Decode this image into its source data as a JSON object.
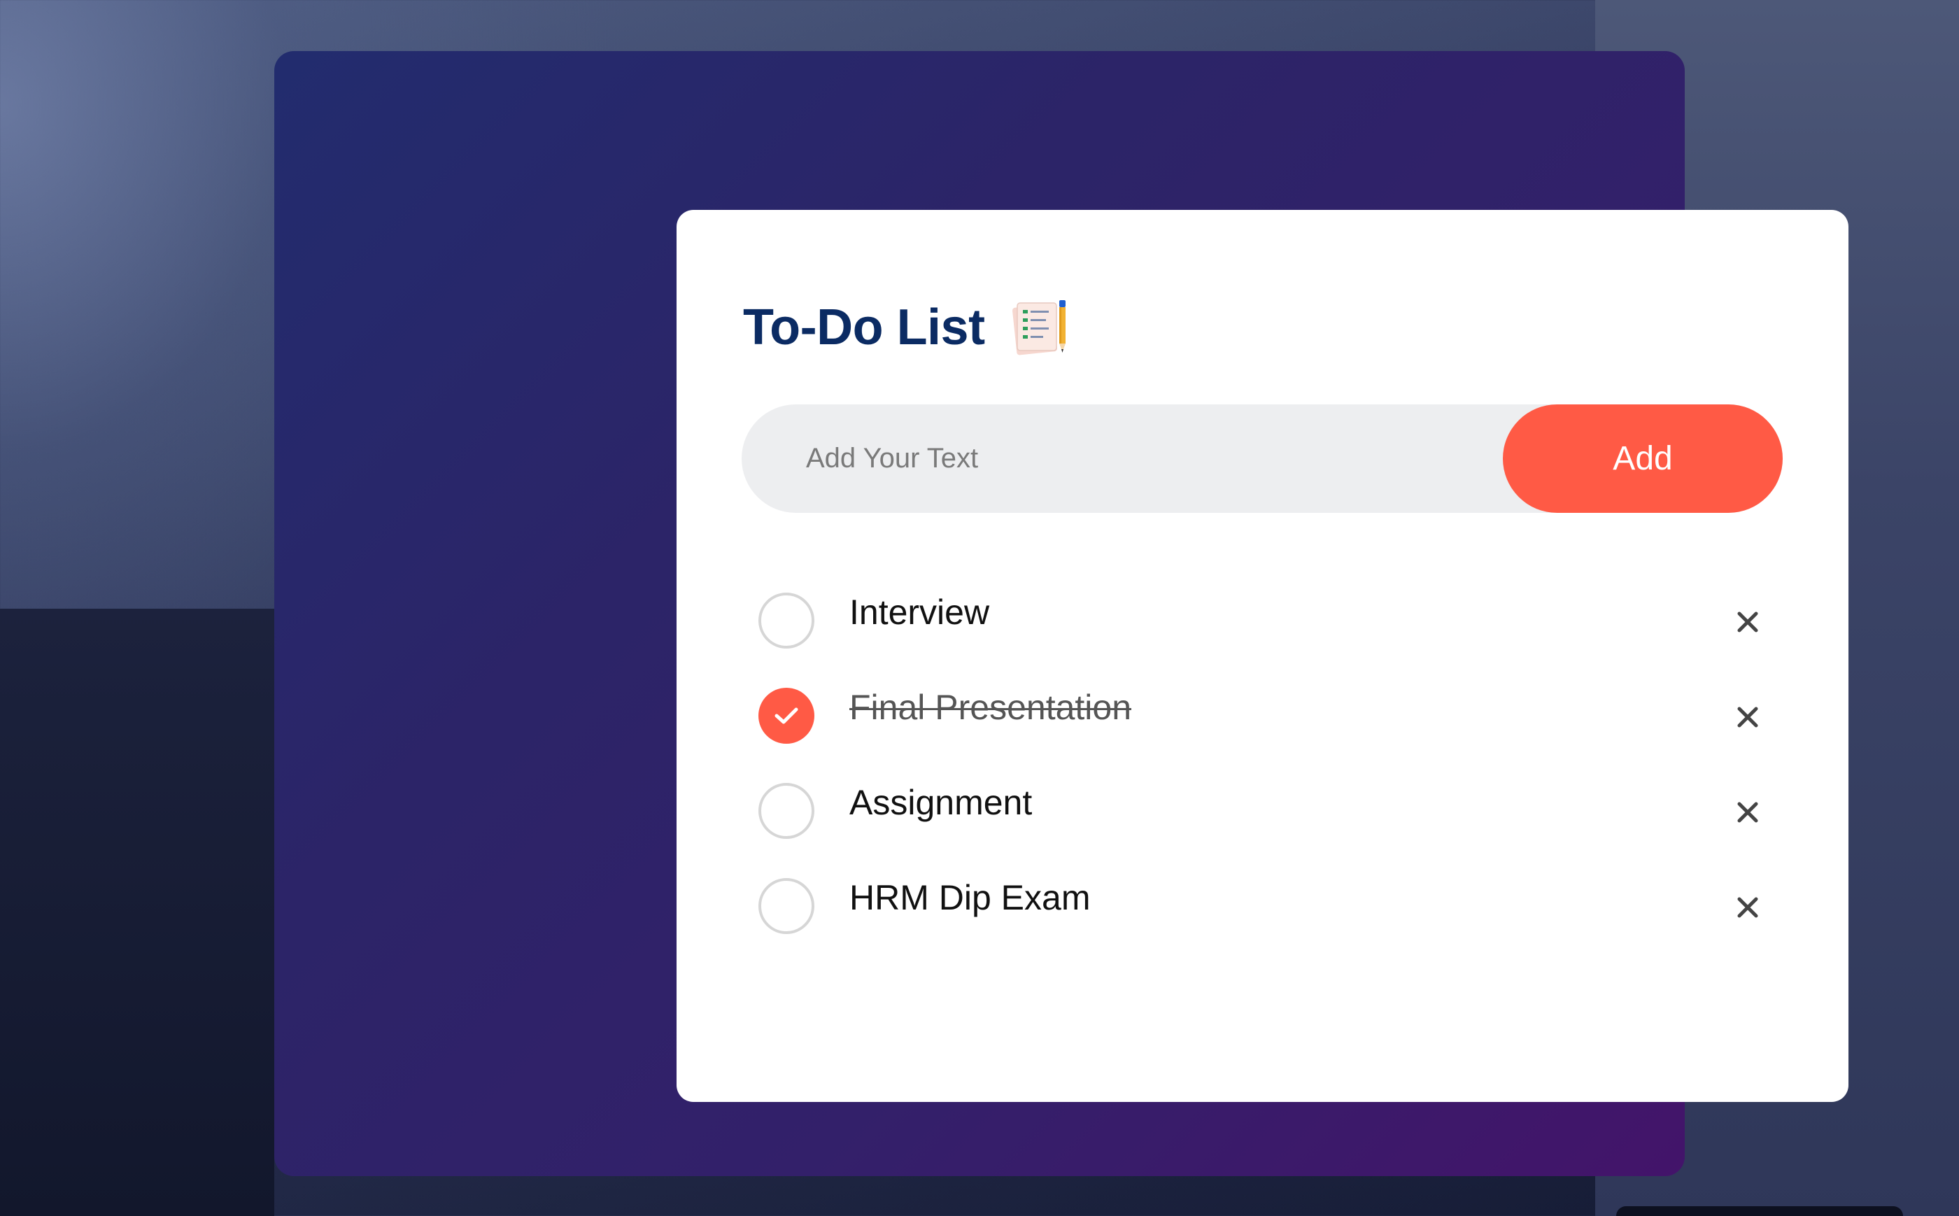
{
  "app": {
    "title": "To-Do List",
    "title_icon": "notepad-pencil-icon"
  },
  "input": {
    "placeholder": "Add Your Text",
    "value": ""
  },
  "add_button": {
    "label": "Add"
  },
  "tasks": [
    {
      "text": "Interview",
      "completed": false
    },
    {
      "text": "Final Presentation",
      "completed": true
    },
    {
      "text": "Assignment",
      "completed": false
    },
    {
      "text": "HRM Dip Exam",
      "completed": false
    }
  ],
  "icons": {
    "unchecked": "empty-circle-icon",
    "checked": "checked-circle-icon",
    "delete": "close-icon"
  },
  "colors": {
    "accent": "#ff5a45",
    "title": "#0b2b63",
    "frame_start": "#222c6e",
    "frame_end": "#43146a",
    "input_bg": "#edeef0"
  }
}
